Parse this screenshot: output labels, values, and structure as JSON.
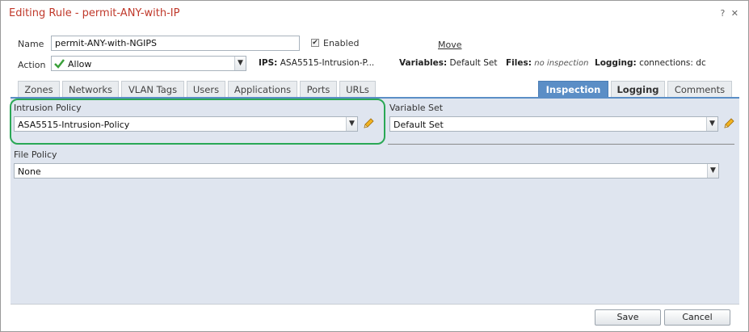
{
  "dialog": {
    "title": "Editing Rule - permit-ANY-with-IP",
    "help_label": "?",
    "close_label": "✕"
  },
  "name_row": {
    "label": "Name",
    "value": "permit-ANY-with-NGIPS",
    "enabled_label": "Enabled",
    "enabled_checked": true,
    "move_label": "Move"
  },
  "action_row": {
    "label": "Action",
    "value": "Allow",
    "ips_label": "IPS:",
    "ips_value": "ASA5515-Intrusion-P...",
    "variables_label": "Variables:",
    "variables_value": "Default Set",
    "files_label": "Files:",
    "files_value": "no inspection",
    "logging_label": "Logging:",
    "logging_value": "connections: dc"
  },
  "tabs": {
    "left": [
      "Zones",
      "Networks",
      "VLAN Tags",
      "Users",
      "Applications",
      "Ports",
      "URLs"
    ],
    "right": [
      "Inspection",
      "Logging",
      "Comments"
    ],
    "active": "Inspection"
  },
  "inspection": {
    "intrusion_policy_label": "Intrusion Policy",
    "intrusion_policy_value": "ASA5515-Intrusion-Policy",
    "variable_set_label": "Variable Set",
    "variable_set_value": "Default Set",
    "file_policy_label": "File Policy",
    "file_policy_value": "None"
  },
  "footer": {
    "save_label": "Save",
    "cancel_label": "Cancel"
  },
  "colors": {
    "title": "#c0392b",
    "active_tab": "#5b8ec6",
    "panel_bg": "#dfe5ef",
    "highlight": "#2aa855"
  }
}
